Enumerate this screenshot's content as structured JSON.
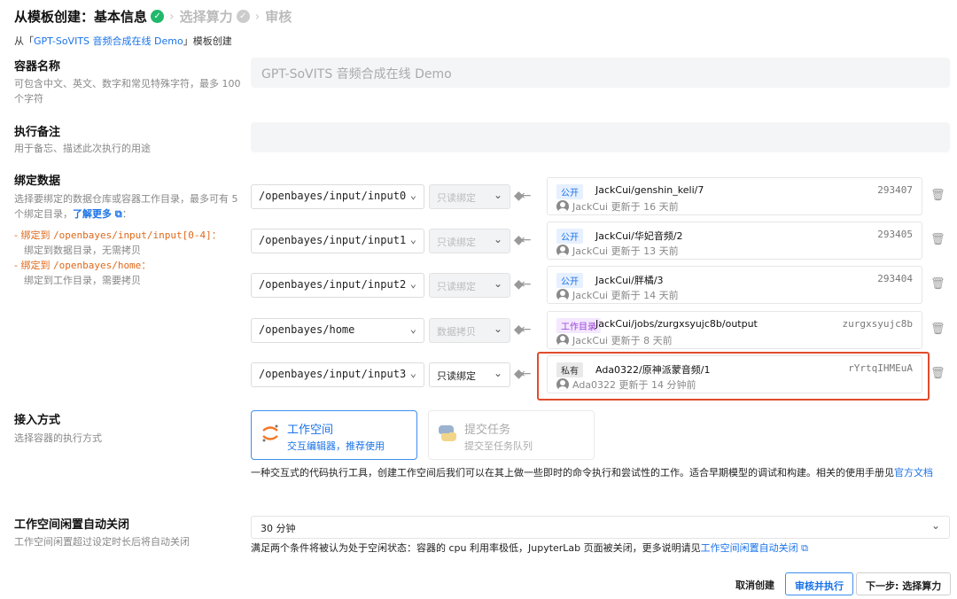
{
  "header": {
    "step1": "从模板创建：基本信息",
    "step2": "选择算力",
    "step3": "审核",
    "from_prefix": "从「",
    "from_link": "GPT-SoVITS 音频合成在线 Demo",
    "from_suffix": "」模板创建"
  },
  "container_name": {
    "label": "容器名称",
    "desc": "可包含中文、英文、数字和常见特殊字符，最多 100 个字符",
    "value": "GPT-SoVITS 音频合成在线 Demo"
  },
  "exec_note": {
    "label": "执行备注",
    "desc": "用于备忘、描述此次执行的用途",
    "value": ""
  },
  "binding": {
    "label": "绑定数据",
    "desc": "选择要绑定的数据仓库或容器工作目录，最多可有 5 个绑定目录，",
    "learn_more": "了解更多",
    "b1_prefix": "- 绑定到 ",
    "b1_path": "/openbayes/input/input[0-4]",
    "b1_colon": "：",
    "b1_note": "绑定到数据目录，无需拷贝",
    "b2_prefix": "- 绑定到 ",
    "b2_path": "/openbayes/home",
    "b2_colon": "：",
    "b2_note": "绑定到工作目录，需要拷贝",
    "rows": [
      {
        "path": "/openbayes/input/input0",
        "mode": "只读绑定",
        "tag": "公开",
        "name": "JackCui/genshin_keli/7",
        "id": "293407",
        "meta": "JackCui 更新于 16 天前"
      },
      {
        "path": "/openbayes/input/input1",
        "mode": "只读绑定",
        "tag": "公开",
        "name": "JackCui/华妃音频/2",
        "id": "293405",
        "meta": "JackCui 更新于 13 天前"
      },
      {
        "path": "/openbayes/input/input2",
        "mode": "只读绑定",
        "tag": "公开",
        "name": "JackCui/胖橘/3",
        "id": "293404",
        "meta": "JackCui 更新于 14 天前"
      },
      {
        "path": "/openbayes/home",
        "mode": "数据拷贝",
        "tag": "工作目录",
        "name": "JackCui/jobs/zurgxsyujc8b/output",
        "id": "zurgxsyujc8b",
        "meta": "JackCui 更新于 8 天前"
      },
      {
        "path": "/openbayes/input/input3",
        "mode": "只读绑定",
        "tag": "私有",
        "name": "Ada0322/原神派蒙音频/1",
        "id": "rYrtqIHMEuA",
        "meta": "Ada0322 更新于 14 分钟前"
      }
    ]
  },
  "access": {
    "label": "接入方式",
    "desc": "选择容器的执行方式",
    "opt1_title": "工作空间",
    "opt1_sub": "交互编辑器，推荐使用",
    "opt2_title": "提交任务",
    "opt2_sub": "提交至任务队列",
    "note": "一种交互式的代码执行工具，创建工作空间后我们可以在其上做一些即时的命令执行和尝试性的工作。适合早期模型的调试和构建。相关的使用手册见",
    "note_link": "官方文档"
  },
  "idle": {
    "label": "工作空间闲置自动关闭",
    "desc": "工作空间闲置超过设定时长后将自动关闭",
    "value": "30 分钟",
    "note": "满足两个条件将被认为处于空闲状态：容器的 cpu 利用率极低，JupyterLab 页面被关闭，更多说明请见",
    "note_link": "工作空间闲置自动关闭"
  },
  "footer": {
    "cancel": "取消创建",
    "review": "审核并执行",
    "next": "下一步: 选择算力"
  },
  "icons": [
    "check-circle-icon",
    "chevron-right-icon",
    "chevron-down-icon",
    "arrow-left-icon",
    "trash-icon",
    "avatar-icon",
    "jupyter-icon",
    "python-icon",
    "external-link-icon"
  ]
}
